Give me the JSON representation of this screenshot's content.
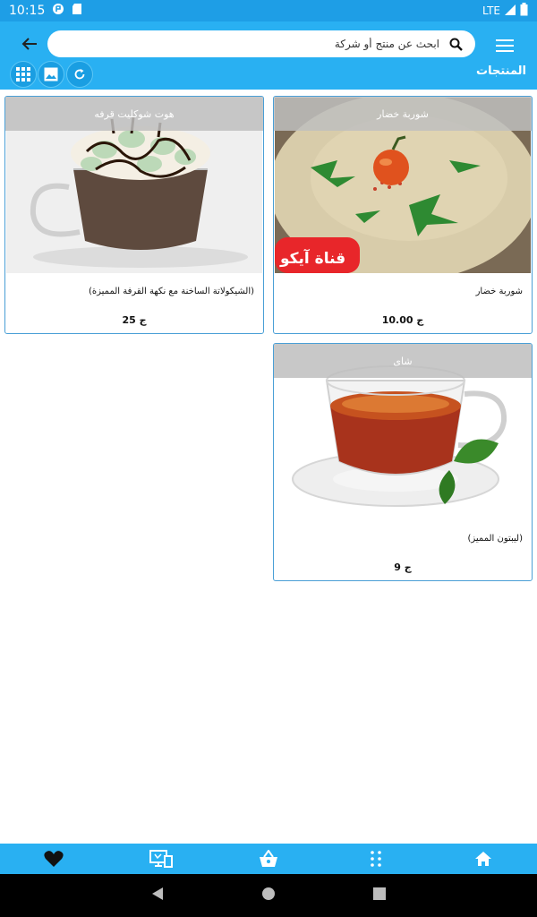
{
  "status_bar": {
    "time": "10:15",
    "network": "LTE"
  },
  "header": {
    "search_placeholder": "ابحث عن منتج أو شركة",
    "page_title": "المنتجات"
  },
  "products": [
    {
      "name": "شوربة خضار",
      "description": "شوربة خضار",
      "price": "10.00 ج"
    },
    {
      "name": "هوت شوكليت قرفه",
      "description": "(الشيكولاتة الساخنة مع نكهة القرفة المميزة)",
      "price": "25 ج"
    },
    {
      "name": "شاى",
      "description": "(ليبتون المميز)",
      "price": "9 ج"
    }
  ],
  "soup_image_watermark": "قناة آيكو",
  "bottom_nav": {
    "items": [
      "home-icon",
      "apps-grid-icon",
      "basket-icon",
      "tv-icon",
      "heart-icon"
    ]
  },
  "colors": {
    "primary": "#29b0f2",
    "status": "#1e9ee6",
    "card_border": "#4a9fd6"
  }
}
